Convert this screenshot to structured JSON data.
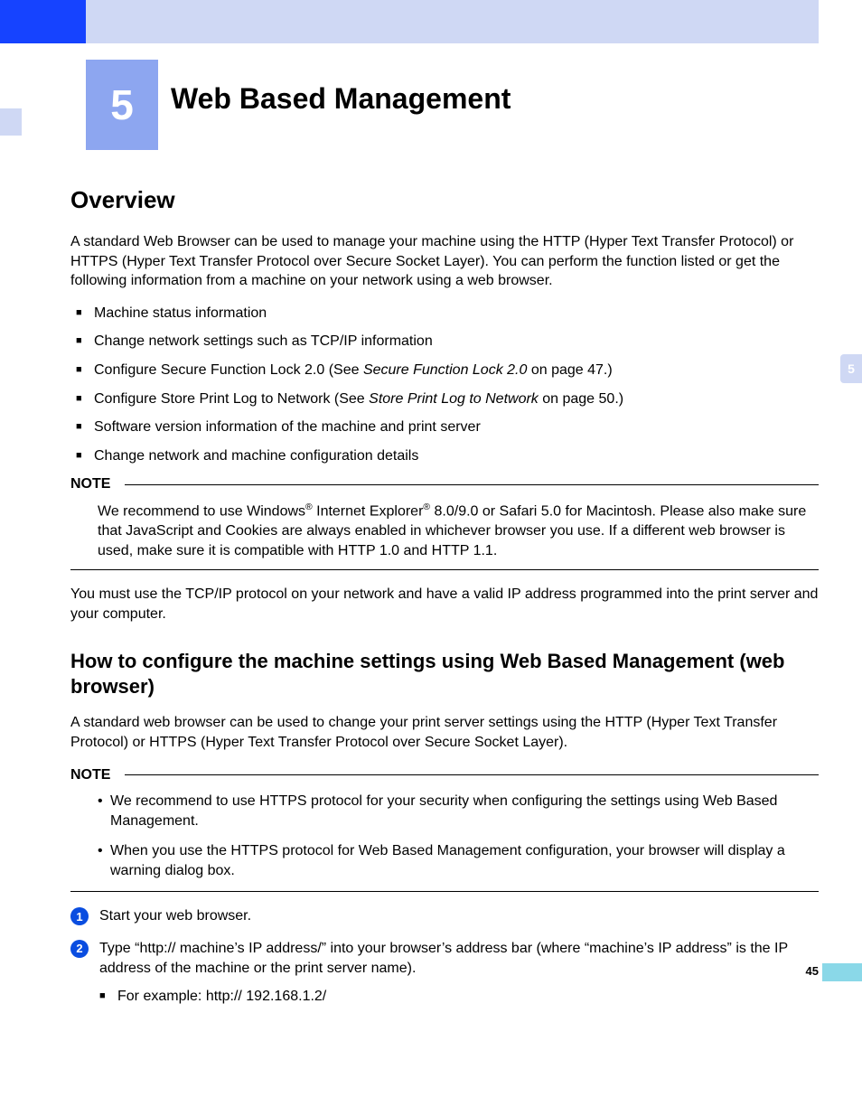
{
  "chapter": {
    "number": "5",
    "title": "Web Based Management"
  },
  "side_tab": "5",
  "page_number": "45",
  "overview": {
    "heading": "Overview",
    "intro": "A standard Web Browser can be used to manage your machine using the HTTP (Hyper Text Transfer Protocol) or HTTPS (Hyper Text Transfer Protocol over Secure Socket Layer). You can perform the function listed or get the following information from a machine on your network using a web browser.",
    "bullets": {
      "b1": "Machine status information",
      "b2": "Change network settings such as TCP/IP information",
      "b3_pre": "Configure Secure Function Lock 2.0 (See ",
      "b3_em": "Secure Function Lock 2.0",
      "b3_post": " on page 47.)",
      "b4_pre": "Configure Store Print Log to Network (See ",
      "b4_em": "Store Print Log to Network",
      "b4_post": " on page 50.)",
      "b5": "Software version information of the machine and print server",
      "b6": "Change network and machine configuration details"
    },
    "note_label": "NOTE",
    "note_pre": "We recommend to use Windows",
    "note_mid": " Internet Explorer",
    "note_rest": " 8.0/9.0 or Safari 5.0 for Macintosh. Please also make sure that JavaScript and Cookies are always enabled in whichever browser you use. If a different web browser is used, make sure it is compatible with HTTP 1.0 and HTTP 1.1.",
    "after_note": "You must use the TCP/IP protocol on your network and have a valid IP address programmed into the print server and your computer."
  },
  "howto": {
    "heading": "How to configure the machine settings using Web Based Management (web browser)",
    "intro": "A standard web browser can be used to change your print server settings using the HTTP (Hyper Text Transfer Protocol) or HTTPS (Hyper Text Transfer Protocol over Secure Socket Layer).",
    "note_label": "NOTE",
    "note_items": {
      "n1": "We recommend to use HTTPS protocol for your security when configuring the settings using Web Based Management.",
      "n2": "When you use the HTTPS protocol for Web Based Management configuration, your browser will display a warning dialog box."
    },
    "steps": {
      "s1_num": "1",
      "s1": "Start your web browser.",
      "s2_num": "2",
      "s2": "Type “http:// machine’s IP address/” into your browser’s address bar (where “machine’s IP address” is the IP address of the machine or the print server name).",
      "s2_sub": "For example: http:// 192.168.1.2/"
    }
  },
  "reg_mark": "®"
}
